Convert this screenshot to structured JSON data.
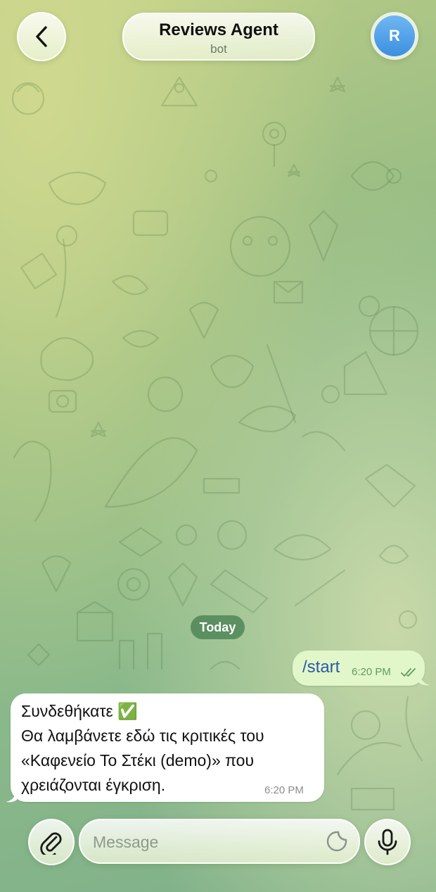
{
  "header": {
    "title": "Reviews Agent",
    "subtitle": "bot",
    "avatar_letter": "R",
    "back_icon": "chevron-left-icon"
  },
  "chat": {
    "date_separator": "Today",
    "messages": [
      {
        "direction": "outgoing",
        "text": "/start",
        "time": "6:20 PM",
        "status": "read"
      },
      {
        "direction": "incoming",
        "lines": [
          "Συνδεθήκατε ✅",
          "Θα λαμβάνετε εδώ τις κριτικές του",
          "«Καφενείο Το Στέκι (demo)» που",
          "χρειάζονται έγκριση."
        ],
        "time": "6:20 PM"
      }
    ]
  },
  "composer": {
    "placeholder": "Message",
    "value": "",
    "attach_icon": "paperclip-icon",
    "sticker_icon": "sticker-icon",
    "mic_icon": "microphone-icon"
  },
  "colors": {
    "outgoing_bubble": "#e2f7c9",
    "incoming_bubble": "#ffffff",
    "command_link": "#2b5aa8",
    "avatar": "#4a9be8",
    "date_chip": "#488052"
  }
}
